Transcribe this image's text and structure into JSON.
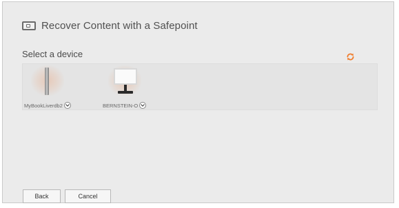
{
  "dialog": {
    "title": "Recover Content with a Safepoint",
    "icon": "drive-icon"
  },
  "devices_section": {
    "label": "Select a device",
    "refresh_icon": "refresh-icon",
    "accent_color": "#f07c2b",
    "devices": [
      {
        "name": "MyBookLiverdb2",
        "icon": "nas-tower-icon"
      },
      {
        "name": "BERNSTEIN-O",
        "icon": "monitor-icon"
      }
    ]
  },
  "footer": {
    "back_label": "Back",
    "cancel_label": "Cancel"
  }
}
